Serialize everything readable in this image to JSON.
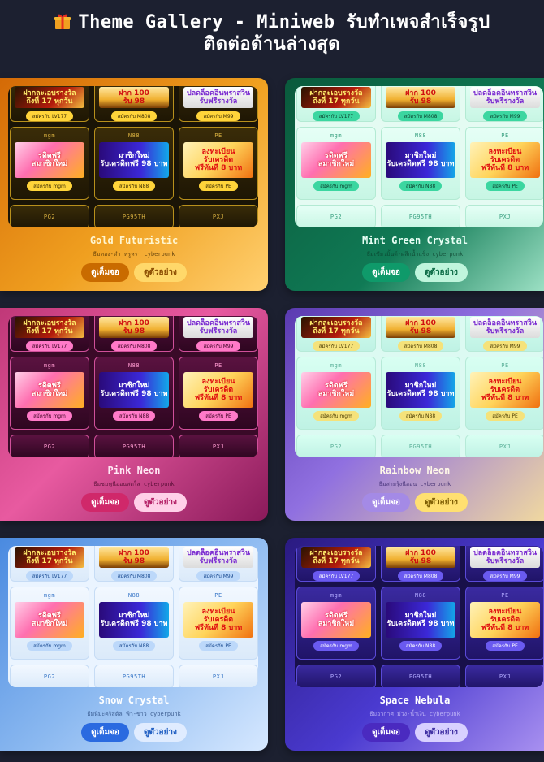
{
  "header": {
    "title_line1": "Theme Gallery - Miniweb รับทำเพจสำเร็จรูป",
    "title_line2": "ติดต่อด้านล่างสุด"
  },
  "preview_tiles": {
    "row1": [
      {
        "banner": "ฝากละเอบรางวัล\nถึงที่ 17 ทุกวัน",
        "pill": "สมัครกับ LV177",
        "banner_class": "b-red"
      },
      {
        "banner": "ฝาก 100\nรับ 98",
        "pill": "สมัครกับ M808",
        "banner_class": "b-gold"
      },
      {
        "banner": "ปลดล็อคอินทราสวิน\nรับฟรีรางวัล",
        "pill": "สมัครกับ M99",
        "banner_class": "b-white"
      }
    ],
    "row2": [
      {
        "name": "mgm",
        "banner": "รดิตฟรี\nสมาชิกใหม่",
        "pill": "สมัครกับ mgm",
        "banner_class": "b-pink"
      },
      {
        "name": "N88",
        "banner": "มาชิกใหม่\nรับเครดิตฟรี 98 บาท",
        "pill": "สมัครกับ N88",
        "banner_class": "b-purple"
      },
      {
        "name": "PE",
        "banner": "ลงทะเบียน\nรับเครดิต\nฟรีทันที 8 บาท",
        "pill": "สมัครกับ PE",
        "banner_class": "b-yellow"
      }
    ],
    "row3": [
      "PG2",
      "PG95TH",
      "PXJ"
    ]
  },
  "cards": [
    {
      "title": "Gold Futuristic",
      "subtitle": "ธีมทอง-ดำ หรูหรา cyberpunk",
      "btn_full": "ดูเต็มจอ",
      "btn_example": "ดูตัวอย่าง"
    },
    {
      "title": "Mint Green Crystal",
      "subtitle": "ธีมเขียวมิ้นต์-ผลึกน้ำแข็ง cyberpunk",
      "btn_full": "ดูเต็มจอ",
      "btn_example": "ดูตัวอย่าง"
    },
    {
      "title": "Pink Neon",
      "subtitle": "ธีมชมพูนีออนสดใส cyberpunk",
      "btn_full": "ดูเต็มจอ",
      "btn_example": "ดูตัวอย่าง"
    },
    {
      "title": "Rainbow Neon",
      "subtitle": "ธีมสายรุ้งนีออน cyberpunk",
      "btn_full": "ดูเต็มจอ",
      "btn_example": "ดูตัวอย่าง"
    },
    {
      "title": "Snow Crystal",
      "subtitle": "ธีมหิมะคริสตัล ฟ้า-ขาว cyberpunk",
      "btn_full": "ดูเต็มจอ",
      "btn_example": "ดูตัวอย่าง"
    },
    {
      "title": "Space Nebula",
      "subtitle": "ธีมอวกาศ ม่วง-น้ำเงิน cyberpunk",
      "btn_full": "ดูเต็มจอ",
      "btn_example": "ดูตัวอย่าง"
    }
  ],
  "themes": [
    {
      "bg": "linear-gradient(135deg,#d46a06 0%,#f0a020 55%,#ffd070 100%)",
      "preview_bg": "#1a1406",
      "tile_bg": "linear-gradient(180deg,#3a2c08,#1e1604)",
      "tile_border": "#b8901c",
      "tname_color": "#d8b040",
      "pill_bg": "#ffd43a",
      "pill_color": "#3a2a00",
      "title_color": "#fff6d0",
      "sub_color": "#3b2400",
      "btn1_bg": "#c96b00",
      "btn1_color": "#fff",
      "btn2_bg": "#ffd86a",
      "btn2_color": "#8a4a00"
    },
    {
      "bg": "linear-gradient(135deg,#0a5a3c 0%,#107a55 60%,#9ce0c4 100%)",
      "preview_bg": "#e4fbf2",
      "tile_bg": "linear-gradient(180deg,#e6fff6,#c7f6e4)",
      "tile_border": "#b3ead3",
      "tname_color": "#3aa080",
      "pill_bg": "#3bd6a0",
      "pill_color": "#0a3a28",
      "title_color": "#e8fff5",
      "sub_color": "#0a3a28",
      "btn1_bg": "#0f9a6a",
      "btn1_color": "#fff",
      "btn2_bg": "#bff5dc",
      "btn2_color": "#0a6a44"
    },
    {
      "bg": "linear-gradient(135deg,#c03878 0%,#e85aa0 45%,#8a1a5a 100%)",
      "preview_bg": "#3a0a28",
      "tile_bg": "linear-gradient(180deg,#5a1240,#2e0620)",
      "tile_border": "#d0509a",
      "tname_color": "#ff9ad0",
      "pill_bg": "#ff7ac8",
      "pill_color": "#3a0020",
      "title_color": "#ffe8f4",
      "sub_color": "#3a0020",
      "btn1_bg": "#d0286a",
      "btn1_color": "#fff",
      "btn2_bg": "#ffd0e8",
      "btn2_color": "#b01860"
    },
    {
      "bg": "linear-gradient(135deg,#5a3ab0 0%,#9070e0 45%,#f0d8a0 100%)",
      "preview_bg": "#dcfaf2",
      "tile_bg": "linear-gradient(180deg,#d8fff2,#bff2e4)",
      "tile_border": "#b6ead8",
      "tname_color": "#5ab098",
      "pill_bg": "#f5e27a",
      "pill_color": "#4a3a00",
      "title_color": "#fff8e8",
      "sub_color": "#2a1a60",
      "btn1_bg": "#a48ae6",
      "btn1_color": "#fff",
      "btn2_bg": "#ffe070",
      "btn2_color": "#7a5a00"
    },
    {
      "bg": "linear-gradient(135deg,#4a8ae0 0%,#8ab8f0 50%,#d6e8ff 100%)",
      "preview_bg": "#eaf4ff",
      "tile_bg": "linear-gradient(180deg,#f2f8ff,#dbeafa)",
      "tile_border": "#c6dcf5",
      "tname_color": "#3a78c8",
      "pill_bg": "#bcd8fa",
      "pill_color": "#1a4a90",
      "title_color": "#ffffff",
      "sub_color": "#1a3a70",
      "btn1_bg": "#2a6ae0",
      "btn1_color": "#fff",
      "btn2_bg": "#e0ecff",
      "btn2_color": "#1a5ac0"
    },
    {
      "bg": "linear-gradient(135deg,#2a1a80 0%,#4a3ad0 55%,#a890f0 100%)",
      "preview_bg": "#18104a",
      "tile_bg": "linear-gradient(180deg,#3a2aa0,#201468)",
      "tile_border": "#5a4ad8",
      "tname_color": "#b0a8ff",
      "pill_bg": "#6a5af0",
      "pill_color": "#ffffff",
      "title_color": "#ffffff",
      "sub_color": "#d8d0ff",
      "btn1_bg": "#4a2ac0",
      "btn1_color": "#fff",
      "btn2_bg": "#d8d0ff",
      "btn2_color": "#3a2aa0"
    }
  ]
}
